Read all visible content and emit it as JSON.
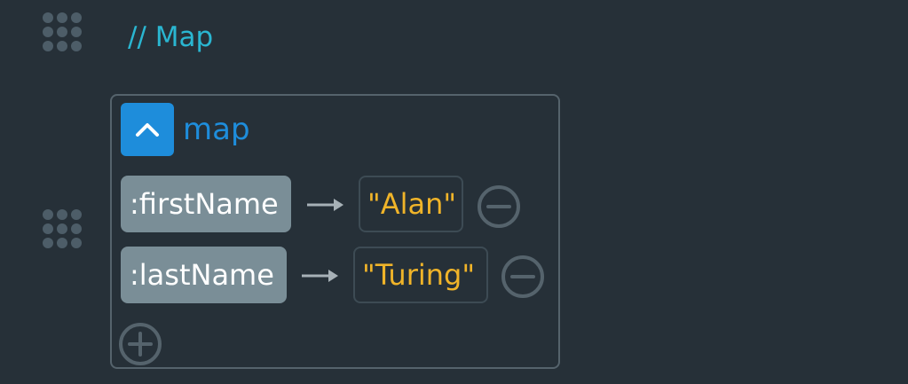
{
  "comment": {
    "text": "// Map"
  },
  "map": {
    "label": "map",
    "entries": [
      {
        "key": ":firstName",
        "value": "\"Alan\""
      },
      {
        "key": ":lastName",
        "value": "\"Turing\""
      }
    ]
  },
  "icons": {
    "drag_handle": "drag-handle-icon",
    "collapse": "chevron-up-icon",
    "arrow": "arrow-right-icon",
    "remove": "minus-circle-icon",
    "add": "plus-circle-icon"
  },
  "colors": {
    "background": "#263038",
    "comment": "#2ab6d1",
    "accent": "#1e8ddb",
    "key_pill": "#7a8e97",
    "string_value": "#f0b429",
    "muted": "#55636c"
  }
}
